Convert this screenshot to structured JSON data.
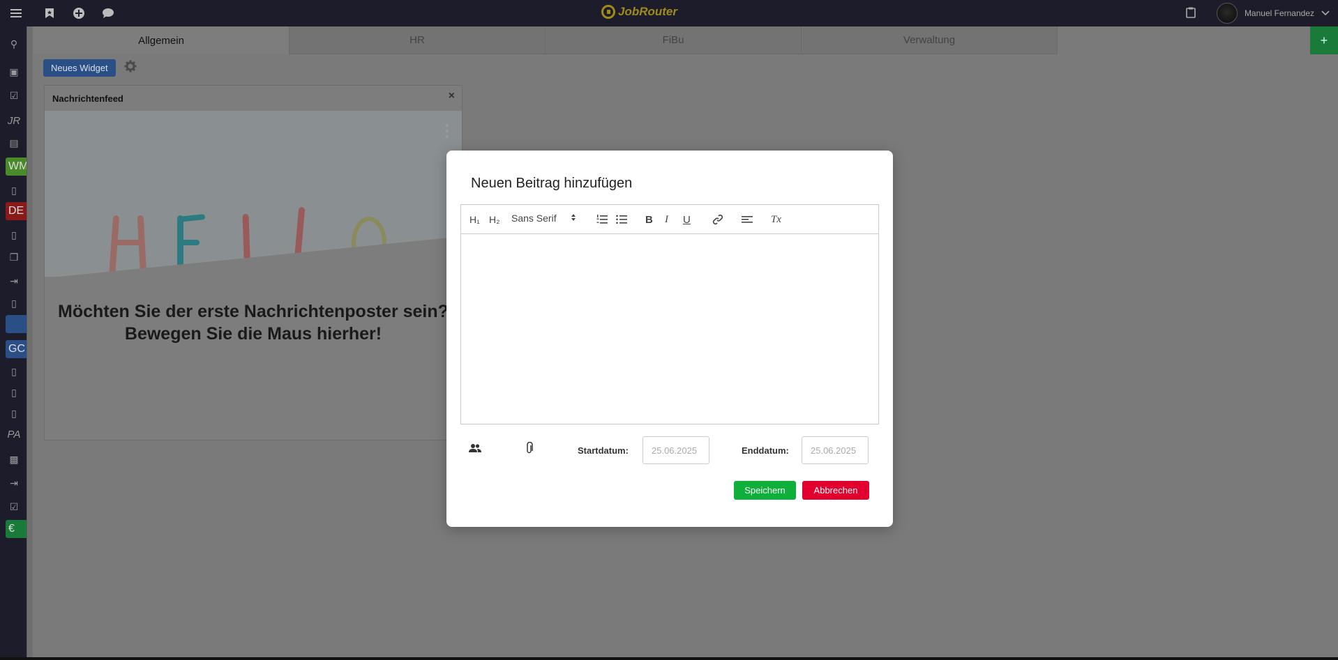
{
  "app": {
    "logo_text": "JobRouter",
    "user_name": "Manuel Fernandez"
  },
  "topbar": {
    "icons": [
      "menu-icon",
      "bookmark-icon",
      "add-circle-icon",
      "chat-icon"
    ],
    "right_icons": [
      "clipboard-icon",
      "chevron-down-icon"
    ]
  },
  "sidebar": {
    "items": [
      {
        "type": "icon",
        "name": "search-icon",
        "glyph": "⚲"
      },
      {
        "type": "icon",
        "name": "inbox-icon",
        "glyph": "▣"
      },
      {
        "type": "icon",
        "name": "task-done-icon",
        "glyph": "☑"
      },
      {
        "type": "text",
        "label": "JR"
      },
      {
        "type": "icon",
        "name": "document-edit-icon",
        "glyph": "▤"
      },
      {
        "type": "badge",
        "label": "WM",
        "color": "#4a8a2a"
      },
      {
        "type": "icon",
        "name": "small-box-icon",
        "glyph": "▯"
      },
      {
        "type": "badge",
        "label": "DE",
        "color": "#8a1a1a"
      },
      {
        "type": "icon",
        "name": "small-box-icon",
        "glyph": "▯"
      },
      {
        "type": "icon",
        "name": "documents-icon",
        "glyph": "❐"
      },
      {
        "type": "icon",
        "name": "login-icon",
        "glyph": "⇥"
      },
      {
        "type": "icon",
        "name": "small-box-icon",
        "glyph": "▯"
      },
      {
        "type": "badge",
        "label": "",
        "color": "#2a4e86"
      },
      {
        "type": "badge",
        "label": "GC",
        "color": "#2a4e86"
      },
      {
        "type": "icon",
        "name": "small-box-icon",
        "glyph": "▯"
      },
      {
        "type": "icon",
        "name": "small-box-icon",
        "glyph": "▯"
      },
      {
        "type": "icon",
        "name": "small-box-icon",
        "glyph": "▯"
      },
      {
        "type": "text",
        "label": "PA"
      },
      {
        "type": "icon",
        "name": "id-badge-icon",
        "glyph": "▩"
      },
      {
        "type": "icon",
        "name": "login-icon",
        "glyph": "⇥"
      },
      {
        "type": "icon",
        "name": "clipboard-check-icon",
        "glyph": "☑"
      },
      {
        "type": "badge",
        "label": "€",
        "color": "#1a7a3a"
      }
    ]
  },
  "tabs": [
    {
      "label": "Allgemein",
      "active": true
    },
    {
      "label": "HR",
      "active": false
    },
    {
      "label": "FiBu",
      "active": false
    },
    {
      "label": "Verwaltung",
      "active": false
    }
  ],
  "tab_add_label": "+",
  "toolbar": {
    "new_widget_label": "Neues Widget"
  },
  "widget": {
    "title": "Nachrichtenfeed",
    "close_glyph": "×",
    "message_line1": "Möchten Sie der erste Nachrichtenposter sein?",
    "message_line2": "Bewegen Sie die Maus hierher!"
  },
  "modal": {
    "title": "Neuen Beitrag hinzufügen",
    "editor": {
      "h1_label": "H₁",
      "h2_label": "H₂",
      "font_select": "Sans Serif",
      "bold": "B",
      "italic": "I",
      "underline": "U",
      "clear_format": "Tx"
    },
    "start_label": "Startdatum:",
    "start_value": "25.06.2025",
    "end_label": "Enddatum:",
    "end_value": "25.06.2025",
    "save_label": "Speichern",
    "cancel_label": "Abbrechen"
  }
}
